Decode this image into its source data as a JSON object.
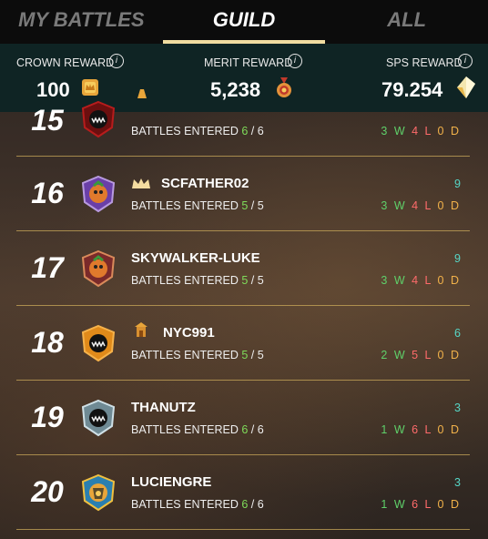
{
  "tabs": [
    {
      "label": "MY BATTLES",
      "active": false
    },
    {
      "label": "GUILD",
      "active": true
    },
    {
      "label": "ALL",
      "active": false
    }
  ],
  "rewards": {
    "crown": {
      "label": "CROWN REWARD",
      "value": "100",
      "icon": "crown-chest-icon"
    },
    "merit": {
      "label": "MERIT REWARD",
      "value": "5,238",
      "icon": "merit-medal-icon"
    },
    "sps": {
      "label": "SPS REWARD",
      "value": "79.254",
      "icon": "sps-crystal-icon"
    }
  },
  "rows": [
    {
      "rank": "15",
      "name": "",
      "entered_label": "BATTLES ENTERED",
      "entered": "6",
      "entered_total": "6",
      "points": "",
      "w": "3",
      "l": "4",
      "d": "0"
    },
    {
      "rank": "16",
      "name": "SCFATHER02",
      "entered_label": "BATTLES ENTERED",
      "entered": "5",
      "entered_total": "5",
      "points": "9",
      "w": "3",
      "l": "4",
      "d": "0"
    },
    {
      "rank": "17",
      "name": "SKYWALKER-LUKE",
      "entered_label": "BATTLES ENTERED",
      "entered": "5",
      "entered_total": "5",
      "points": "9",
      "w": "3",
      "l": "4",
      "d": "0"
    },
    {
      "rank": "18",
      "name": "NYC991",
      "entered_label": "BATTLES ENTERED",
      "entered": "5",
      "entered_total": "5",
      "points": "6",
      "w": "2",
      "l": "5",
      "d": "0"
    },
    {
      "rank": "19",
      "name": "THANUTZ",
      "entered_label": "BATTLES ENTERED",
      "entered": "6",
      "entered_total": "6",
      "points": "3",
      "w": "1",
      "l": "6",
      "d": "0"
    },
    {
      "rank": "20",
      "name": "LUCIENGRE",
      "entered_label": "BATTLES ENTERED",
      "entered": "6",
      "entered_total": "6",
      "points": "3",
      "w": "1",
      "l": "6",
      "d": "0"
    }
  ],
  "letters": {
    "w": "W",
    "l": "L",
    "d": "D",
    "sep": "/"
  },
  "colors": {
    "accent": "#f0dca0",
    "header_bg": "#0f2424",
    "entered_green": "#7fdc5a",
    "points_teal": "#56d6c6"
  }
}
